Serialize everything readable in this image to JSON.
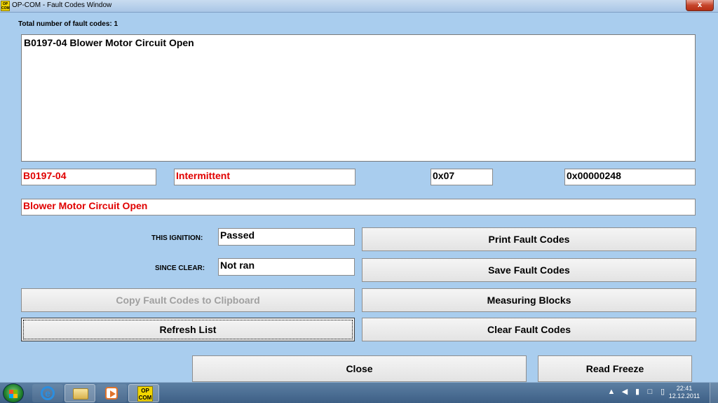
{
  "window": {
    "title": "OP-COM - Fault Codes Window",
    "app_icon_text": "OP\nCOM",
    "close_label": "x"
  },
  "summary": {
    "total_label": "Total number of fault codes:",
    "total_count": "1"
  },
  "fault_list": {
    "items": [
      "B0197-04 Blower Motor Circuit Open"
    ]
  },
  "details": {
    "code": "B0197-04",
    "status": "Intermittent",
    "hex_value": "0x07",
    "hex_address": "0x00000248",
    "description": "Blower Motor Circuit Open"
  },
  "test_status": {
    "this_ignition_label": "THIS IGNITION:",
    "this_ignition_value": "Passed",
    "since_clear_label": "SINCE CLEAR:",
    "since_clear_value": "Not ran"
  },
  "buttons": {
    "print": "Print Fault Codes",
    "save": "Save Fault Codes",
    "copy": "Copy Fault Codes to Clipboard",
    "measuring": "Measuring Blocks",
    "refresh": "Refresh List",
    "clear": "Clear Fault Codes",
    "close": "Close",
    "read_freeze": "Read Freeze"
  },
  "taskbar": {
    "opcom_label": "OP\nCOM",
    "ie_glyph": "e",
    "time": "22:41",
    "date": "12.12.2011"
  }
}
